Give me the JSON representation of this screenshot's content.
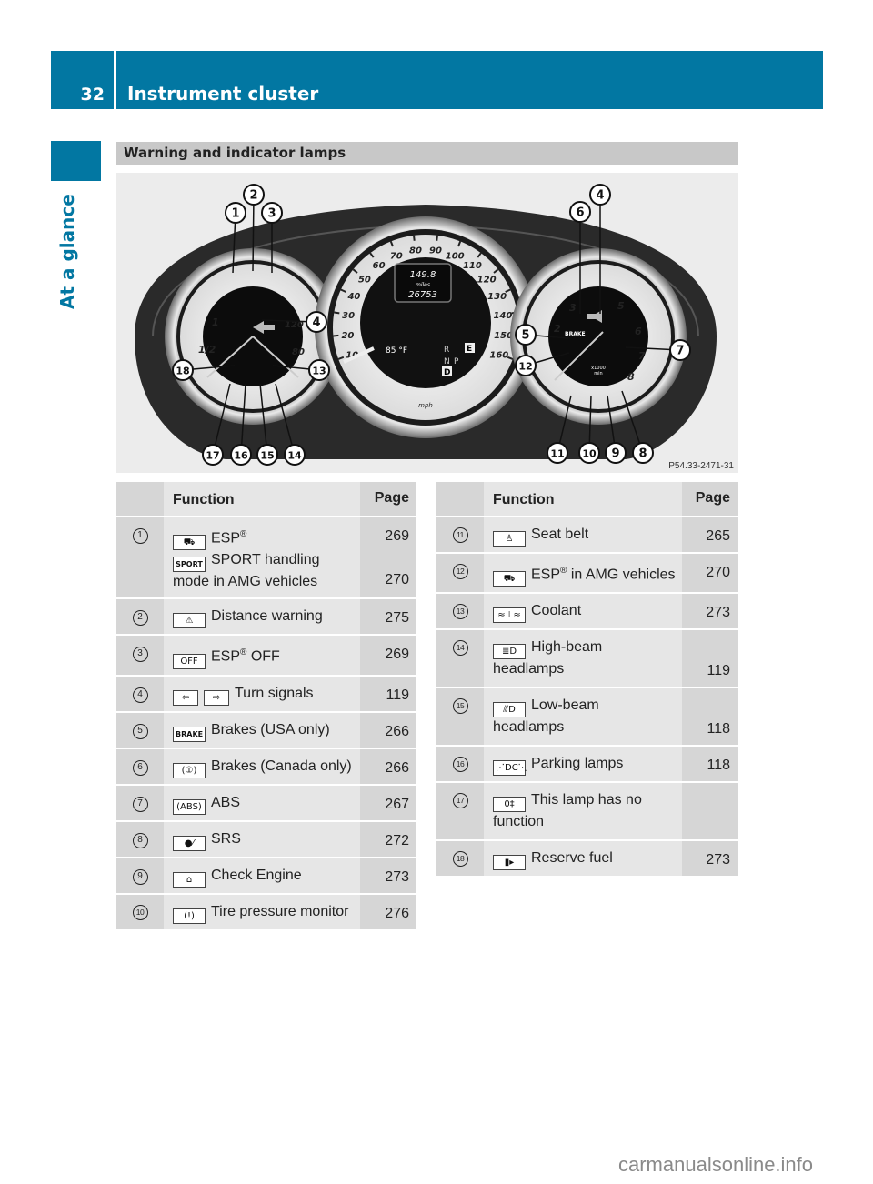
{
  "header": {
    "page_number": "32",
    "chapter_title": "Instrument cluster"
  },
  "sidebar": {
    "section_label": "At a glance"
  },
  "section": {
    "title": "Warning and indicator lamps"
  },
  "figure": {
    "code": "P54.33-2471-31",
    "speedometer": {
      "unit": "mph",
      "ticks": [
        "10",
        "20",
        "30",
        "40",
        "50",
        "60",
        "70",
        "80",
        "90",
        "100",
        "110",
        "120",
        "130",
        "140",
        "150",
        "160"
      ],
      "display_top": "149.8",
      "display_mid": "miles",
      "display_bottom": "26753",
      "outside_temp": "85 °F",
      "gear_options": [
        "R",
        "N",
        "P",
        "D"
      ],
      "gear_selected": "D",
      "mode": "E"
    },
    "left_gauge": {
      "ticks": [
        "1",
        "1/2",
        "120",
        "80"
      ]
    },
    "tachometer": {
      "ticks": [
        "2",
        "3",
        "5",
        "6",
        "7",
        "8"
      ],
      "unit_line1": "x1000",
      "unit_line2": "min",
      "brake_label": "BRAKE"
    },
    "callouts": [
      "1",
      "2",
      "3",
      "4",
      "5",
      "6",
      "7",
      "8",
      "9",
      "10",
      "11",
      "12",
      "13",
      "14",
      "15",
      "16",
      "17",
      "18"
    ]
  },
  "tables": [
    {
      "headers": {
        "index": "",
        "function": "Function",
        "page": "Page"
      },
      "rows": [
        {
          "index": "1",
          "lines": [
            {
              "icon": "esp-icon",
              "icon_text": "",
              "text": "ESP",
              "sup": "®",
              "page": "269"
            },
            {
              "icon": "sport-icon",
              "icon_text": "SPORT",
              "text": "SPORT handling",
              "page": ""
            },
            {
              "icon": "",
              "text": "mode in AMG vehicles",
              "page": "270"
            }
          ]
        },
        {
          "index": "2",
          "lines": [
            {
              "icon": "distance-warning-icon",
              "icon_text": "⚠",
              "text": "Distance warning",
              "page": "275"
            }
          ]
        },
        {
          "index": "3",
          "lines": [
            {
              "icon": "esp-off-icon",
              "icon_text": "OFF",
              "text": "ESP",
              "sup": "®",
              "text_after": " OFF",
              "page": "269"
            }
          ]
        },
        {
          "index": "4",
          "lines": [
            {
              "icon": "turn-signal-icons",
              "icon_text": "⇦",
              "icon_text2": "⇨",
              "text": "Turn signals",
              "page": "119"
            }
          ]
        },
        {
          "index": "5",
          "lines": [
            {
              "icon": "brake-icon",
              "icon_text": "BRAKE",
              "text": "Brakes (USA only)",
              "page": "266"
            }
          ]
        },
        {
          "index": "6",
          "lines": [
            {
              "icon": "brake-canada-icon",
              "icon_text": "(①)",
              "text": "Brakes (Canada only)",
              "page": "266"
            }
          ]
        },
        {
          "index": "7",
          "lines": [
            {
              "icon": "abs-icon",
              "icon_text": "(ABS)",
              "text": "ABS",
              "page": "267"
            }
          ]
        },
        {
          "index": "8",
          "lines": [
            {
              "icon": "srs-icon",
              "icon_text": "●⁄",
              "text": "SRS",
              "page": "272"
            }
          ]
        },
        {
          "index": "9",
          "lines": [
            {
              "icon": "check-engine-icon",
              "icon_text": "⌂",
              "text": "Check Engine",
              "page": "273"
            }
          ]
        },
        {
          "index": "10",
          "lines": [
            {
              "icon": "tire-pressure-icon",
              "icon_text": "(!)",
              "text": "Tire pressure monitor",
              "page": "276"
            }
          ]
        }
      ]
    },
    {
      "headers": {
        "index": "",
        "function": "Function",
        "page": "Page"
      },
      "rows": [
        {
          "index": "11",
          "lines": [
            {
              "icon": "seat-belt-icon",
              "icon_text": "♙",
              "text": "Seat belt",
              "page": "265"
            }
          ]
        },
        {
          "index": "12",
          "lines": [
            {
              "icon": "esp-amg-icon",
              "icon_text": "",
              "text": "ESP",
              "sup": "®",
              "text_after": " in AMG vehicles",
              "page": "270"
            }
          ]
        },
        {
          "index": "13",
          "lines": [
            {
              "icon": "coolant-icon",
              "icon_text": "≈⊥≈",
              "text": "Coolant",
              "page": "273"
            }
          ]
        },
        {
          "index": "14",
          "lines": [
            {
              "icon": "high-beam-icon",
              "icon_text": "≣D",
              "text": "High-beam",
              "page": ""
            },
            {
              "icon": "",
              "text": "headlamps",
              "page": "119"
            }
          ]
        },
        {
          "index": "15",
          "lines": [
            {
              "icon": "low-beam-icon",
              "icon_text": "⫻D",
              "text": "Low-beam",
              "page": ""
            },
            {
              "icon": "",
              "text": "headlamps",
              "page": "118"
            }
          ]
        },
        {
          "index": "16",
          "lines": [
            {
              "icon": "parking-lamps-icon",
              "icon_text": "⋰DC⋱",
              "text": "Parking lamps",
              "page": "118"
            }
          ]
        },
        {
          "index": "17",
          "lines": [
            {
              "icon": "rear-fog-icon",
              "icon_text": "0‡",
              "text": "This lamp has no",
              "page": ""
            },
            {
              "icon": "",
              "text": "function",
              "page": ""
            }
          ]
        },
        {
          "index": "18",
          "lines": [
            {
              "icon": "reserve-fuel-icon",
              "icon_text": "▮▸",
              "text": "Reserve fuel",
              "page": "273"
            }
          ]
        }
      ]
    }
  ],
  "watermark": "carmanualsonline.info"
}
